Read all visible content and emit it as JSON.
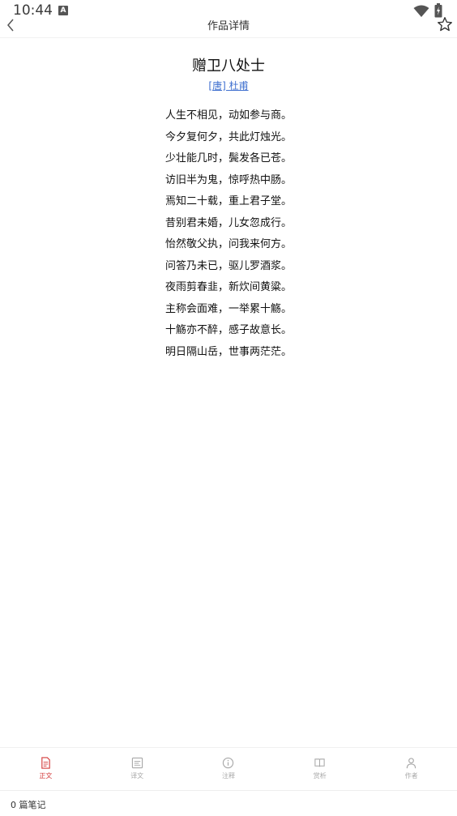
{
  "status": {
    "time": "10:44",
    "notif_badge": "A"
  },
  "header": {
    "title": "作品详情",
    "back_icon": "chevron-left-icon",
    "favorite_icon": "star-outline-icon"
  },
  "poem": {
    "title": "赠卫八处士",
    "author": "[唐] 杜甫",
    "lines": [
      "人生不相见，动如参与商。",
      "今夕复何夕，共此灯烛光。",
      "少壮能几时，鬓发各已苍。",
      "访旧半为鬼，惊呼热中肠。",
      "焉知二十载，重上君子堂。",
      "昔别君未婚，儿女忽成行。",
      "怡然敬父执，问我来何方。",
      "问答乃未已，驱儿罗酒浆。",
      "夜雨剪春韭，新炊间黄粱。",
      "主称会面难，一举累十觞。",
      "十觞亦不醉，感子故意长。",
      "明日隔山岳，世事两茫茫。"
    ]
  },
  "tabs": [
    {
      "label": "正文",
      "icon": "document-icon",
      "active": true
    },
    {
      "label": "译文",
      "icon": "translate-icon",
      "active": false
    },
    {
      "label": "注释",
      "icon": "info-icon",
      "active": false
    },
    {
      "label": "赏析",
      "icon": "book-icon",
      "active": false
    },
    {
      "label": "作者",
      "icon": "person-icon",
      "active": false
    }
  ],
  "notes": {
    "label": "0 篇笔记"
  },
  "colors": {
    "accent": "#d33a3a",
    "link": "#3f6fcf",
    "inactive": "#a8a8a8"
  }
}
